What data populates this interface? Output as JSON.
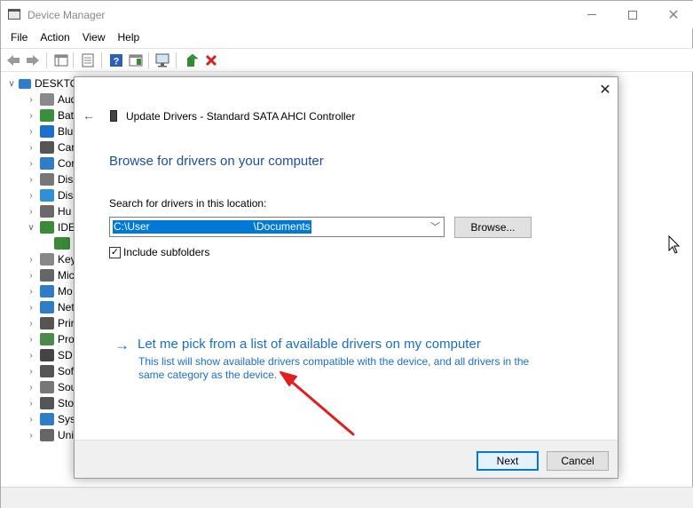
{
  "window": {
    "title": "Device Manager"
  },
  "menu": [
    "File",
    "Action",
    "View",
    "Help"
  ],
  "tree": {
    "root": "DESKTO",
    "items": [
      {
        "label": "Aud",
        "color": "#8a8a8a",
        "expanded": false
      },
      {
        "label": "Bat",
        "color": "#3a8f3a",
        "expanded": false
      },
      {
        "label": "Blu",
        "color": "#1a6fd0",
        "expanded": false
      },
      {
        "label": "Car",
        "color": "#555555",
        "expanded": false
      },
      {
        "label": "Cor",
        "color": "#2d7dc9",
        "expanded": false
      },
      {
        "label": "Dis",
        "color": "#777777",
        "expanded": false
      },
      {
        "label": "Dis",
        "color": "#2f8fd8",
        "expanded": false
      },
      {
        "label": "Hu",
        "color": "#6a6a6a",
        "expanded": false
      },
      {
        "label": "IDE",
        "color": "#3a8a3a",
        "expanded": true
      },
      {
        "label": "",
        "color": "#3a8a3a",
        "expanded": null
      },
      {
        "label": "Key",
        "color": "#888888",
        "expanded": false
      },
      {
        "label": "Mic",
        "color": "#666666",
        "expanded": false
      },
      {
        "label": "Mo",
        "color": "#2d7dc9",
        "expanded": false
      },
      {
        "label": "Net",
        "color": "#2d7dc9",
        "expanded": false
      },
      {
        "label": "Prir",
        "color": "#555555",
        "expanded": false
      },
      {
        "label": "Pro",
        "color": "#4a8a4a",
        "expanded": false
      },
      {
        "label": "SD",
        "color": "#444444",
        "expanded": false
      },
      {
        "label": "Sof",
        "color": "#555555",
        "expanded": false
      },
      {
        "label": "Sou",
        "color": "#777777",
        "expanded": false
      },
      {
        "label": "Sto",
        "color": "#555555",
        "expanded": false
      },
      {
        "label": "Sys",
        "color": "#2d7dc9",
        "expanded": false
      },
      {
        "label": "Uni",
        "color": "#666666",
        "expanded": false
      }
    ]
  },
  "wizard": {
    "header": "Update Drivers - Standard SATA AHCI Controller",
    "heading": "Browse for drivers on your computer",
    "search_label": "Search for drivers in this location:",
    "path_start": "C:\\User",
    "path_end": "\\Documents",
    "browse_label": "Browse...",
    "subfolders_label": "Include subfolders",
    "subfolders_checked": true,
    "pick_arrow": "→",
    "pick_title": "Let me pick from a list of available drivers on my computer",
    "pick_desc": "This list will show available drivers compatible with the device, and all drivers in the same category as the device.",
    "next_label": "Next",
    "cancel_label": "Cancel"
  },
  "colors": {
    "link": "#1a6fc4",
    "heading": "#1f4d96",
    "selection": "#0078d7",
    "annotation_arrow": "#e0201c"
  }
}
